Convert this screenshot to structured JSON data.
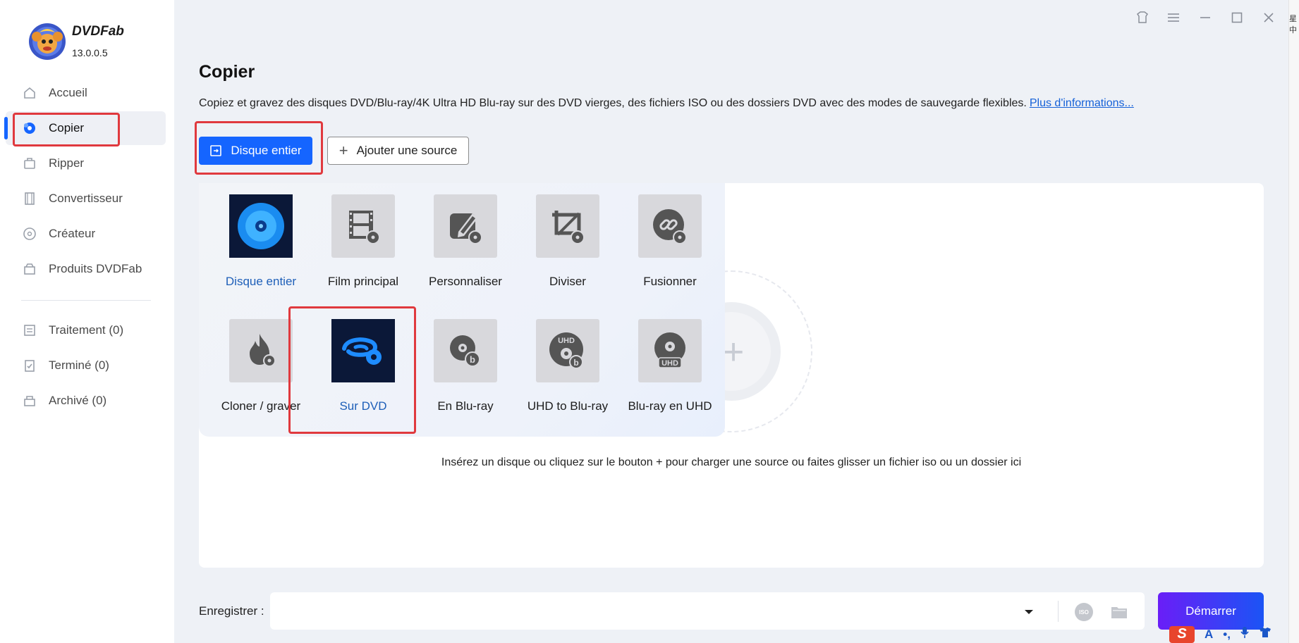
{
  "app": {
    "brand": "DVDFab",
    "version": "13.0.0.5"
  },
  "sidebar": {
    "items": [
      {
        "label": "Accueil",
        "icon": "home-icon"
      },
      {
        "label": "Copier",
        "icon": "copy-disc-icon"
      },
      {
        "label": "Ripper",
        "icon": "ripper-icon"
      },
      {
        "label": "Convertisseur",
        "icon": "film-icon"
      },
      {
        "label": "Créateur",
        "icon": "creator-icon"
      },
      {
        "label": "Produits DVDFab",
        "icon": "box-icon"
      }
    ],
    "queue": [
      {
        "label": "Traitement (0)",
        "icon": "list-icon"
      },
      {
        "label": "Terminé (0)",
        "icon": "clipboard-check-icon"
      },
      {
        "label": "Archivé (0)",
        "icon": "archive-icon"
      }
    ]
  },
  "header": {
    "title": "Copier",
    "description": "Copiez et gravez des disques DVD/Blu-ray/4K Ultra HD Blu-ray sur des DVD vierges, des fichiers ISO ou des dossiers DVD avec des modes de sauvegarde flexibles.",
    "more_link": "Plus d'informations..."
  },
  "toolbar": {
    "mode_button": "Disque entier",
    "add_source": "Ajouter une source"
  },
  "modes": {
    "row1": [
      {
        "label": "Disque entier",
        "icon": "full-disc-icon",
        "selected": true
      },
      {
        "label": "Film principal",
        "icon": "main-movie-icon"
      },
      {
        "label": "Personnaliser",
        "icon": "customize-icon"
      },
      {
        "label": "Diviser",
        "icon": "split-icon"
      },
      {
        "label": "Fusionner",
        "icon": "merge-icon"
      }
    ],
    "row2": [
      {
        "label": "Cloner / graver",
        "icon": "clone-burn-icon"
      },
      {
        "label": "Sur DVD",
        "icon": "to-dvd-icon",
        "selected": true
      },
      {
        "label": "En Blu-ray",
        "icon": "to-bluray-icon"
      },
      {
        "label": "UHD to Blu-ray",
        "icon": "uhd-to-bluray-icon"
      },
      {
        "label": "Blu-ray en UHD",
        "icon": "bluray-to-uhd-icon"
      }
    ]
  },
  "drop_hint": "Insérez un disque ou cliquez sur le bouton +  pour charger une source ou faites glisser un fichier iso ou un dossier ici",
  "bottom": {
    "save_label": "Enregistrer :",
    "iso": "ISO",
    "start": "Démarrer"
  },
  "colors": {
    "accent": "#1565ff",
    "highlight": "#e0393e",
    "selected_text": "#1e5fb8"
  },
  "edge": {
    "strip_text": "星中",
    "ime_letter": "S",
    "ime_a": "A"
  }
}
